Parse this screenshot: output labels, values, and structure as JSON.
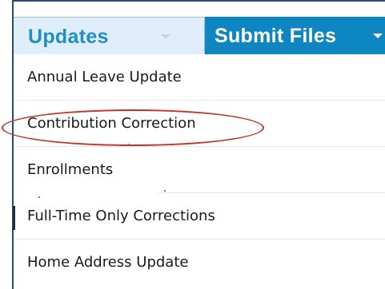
{
  "tabs": [
    {
      "label": "Updates",
      "active": true,
      "icon": "chevron-down-icon"
    },
    {
      "label": "Submit Files",
      "active": false,
      "icon": "chevron-down-icon"
    }
  ],
  "menu": {
    "items": [
      {
        "label": "Annual Leave Update"
      },
      {
        "label": "Contribution Correction",
        "highlighted": true
      },
      {
        "label": "Enrollments"
      },
      {
        "label": "Full-Time Only Corrections"
      },
      {
        "label": "Home Address Update"
      }
    ]
  },
  "colors": {
    "updates_tab_bg": "#dfeefa",
    "updates_tab_text": "#1f8fc8",
    "submit_tab_bg": "#0e86c2",
    "highlight_oval": "#c0332f"
  }
}
